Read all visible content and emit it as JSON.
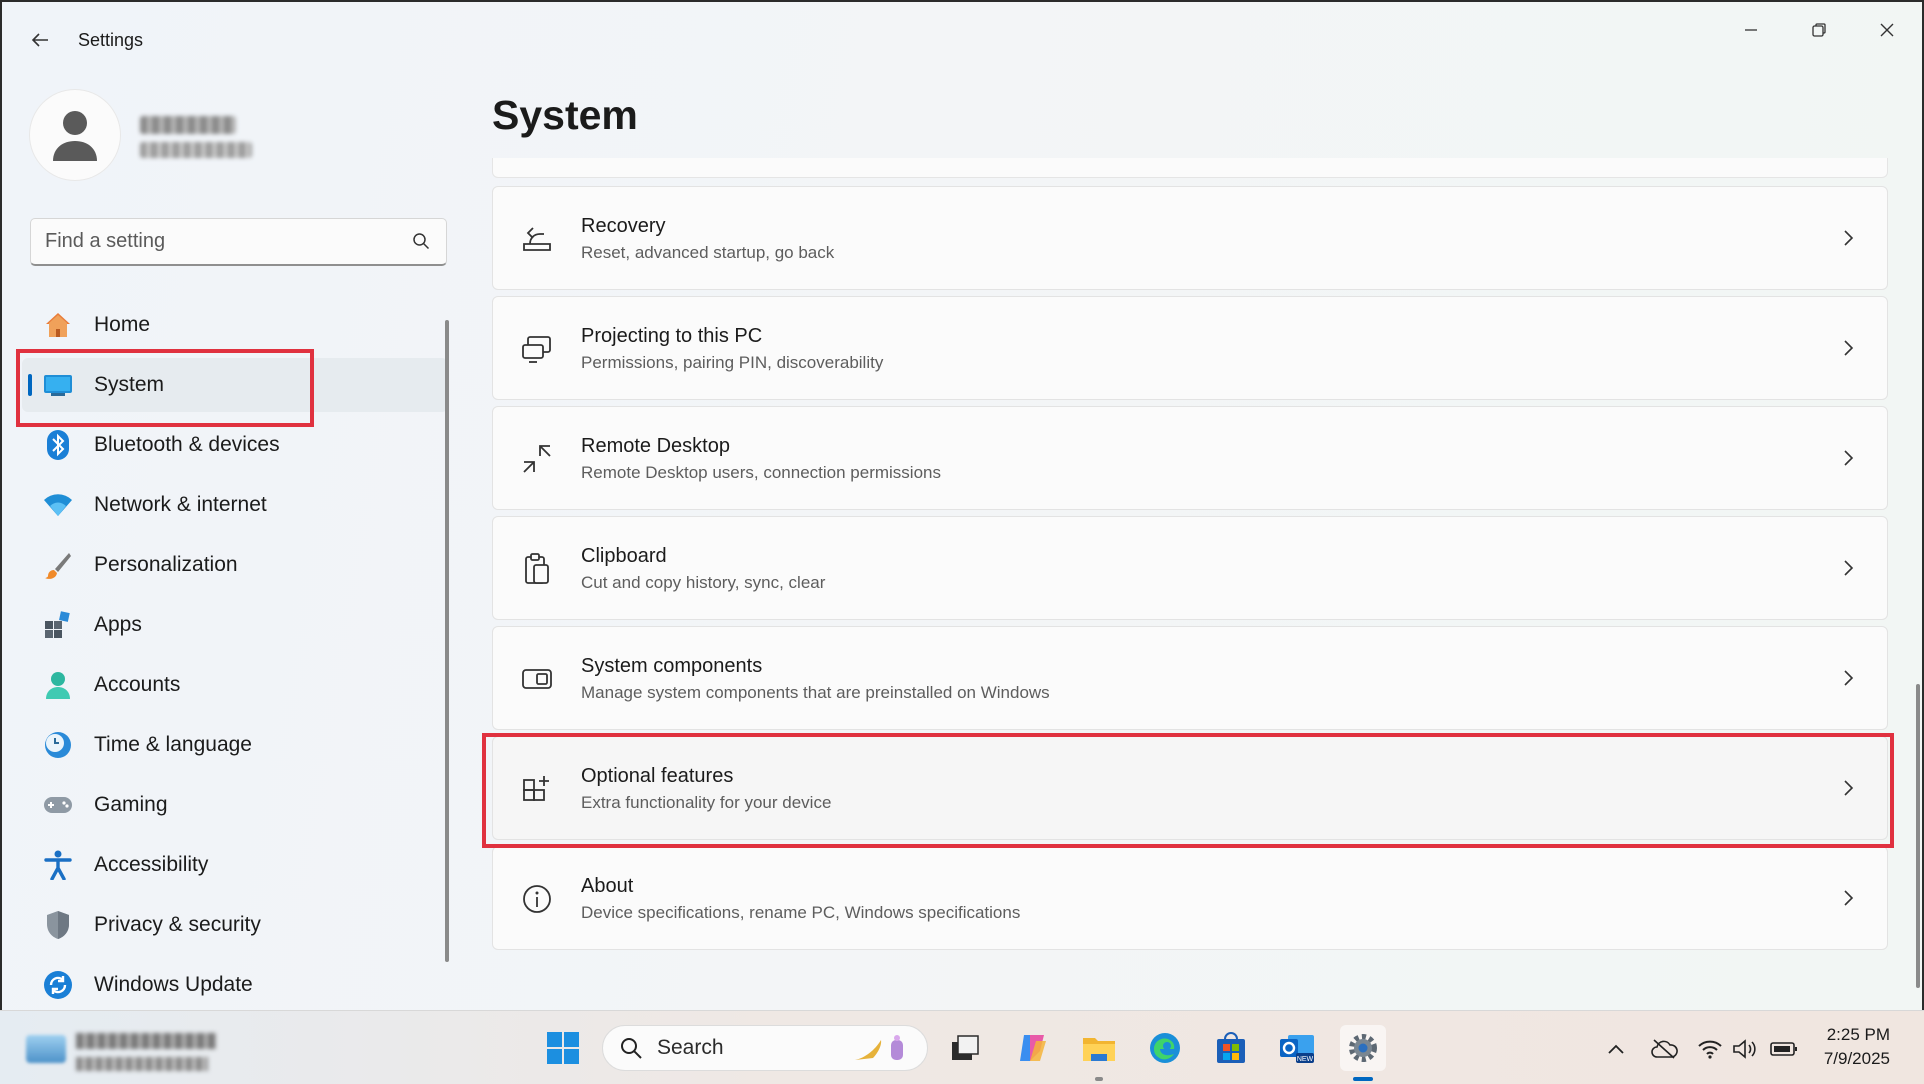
{
  "window": {
    "title": "Settings"
  },
  "profile": {
    "name": "",
    "email": ""
  },
  "search": {
    "placeholder": "Find a setting"
  },
  "sidebar": {
    "items": [
      {
        "label": "Home",
        "icon": "home-icon"
      },
      {
        "label": "System",
        "icon": "system-icon",
        "active": true
      },
      {
        "label": "Bluetooth & devices",
        "icon": "bluetooth-icon"
      },
      {
        "label": "Network & internet",
        "icon": "wifi-icon"
      },
      {
        "label": "Personalization",
        "icon": "brush-icon"
      },
      {
        "label": "Apps",
        "icon": "apps-icon"
      },
      {
        "label": "Accounts",
        "icon": "accounts-icon"
      },
      {
        "label": "Time & language",
        "icon": "clock-globe-icon"
      },
      {
        "label": "Gaming",
        "icon": "gamepad-icon"
      },
      {
        "label": "Accessibility",
        "icon": "accessibility-icon"
      },
      {
        "label": "Privacy & security",
        "icon": "shield-icon"
      },
      {
        "label": "Windows Update",
        "icon": "update-icon"
      }
    ]
  },
  "main": {
    "title": "System",
    "cards": [
      {
        "title": "Recovery",
        "subtitle": "Reset, advanced startup, go back",
        "icon": "recovery-icon"
      },
      {
        "title": "Projecting to this PC",
        "subtitle": "Permissions, pairing PIN, discoverability",
        "icon": "projecting-icon"
      },
      {
        "title": "Remote Desktop",
        "subtitle": "Remote Desktop users, connection permissions",
        "icon": "remote-desktop-icon"
      },
      {
        "title": "Clipboard",
        "subtitle": "Cut and copy history, sync, clear",
        "icon": "clipboard-icon"
      },
      {
        "title": "System components",
        "subtitle": "Manage system components that are preinstalled on Windows",
        "icon": "system-components-icon"
      },
      {
        "title": "Optional features",
        "subtitle": "Extra functionality for your device",
        "icon": "optional-features-icon",
        "highlighted": true
      },
      {
        "title": "About",
        "subtitle": "Device specifications, rename PC, Windows specifications",
        "icon": "info-icon"
      }
    ]
  },
  "taskbar": {
    "search_label": "Search",
    "time": "2:25 PM",
    "date": "7/9/2025"
  },
  "colors": {
    "accent": "#0067c0",
    "highlight_box": "#e0313f"
  }
}
